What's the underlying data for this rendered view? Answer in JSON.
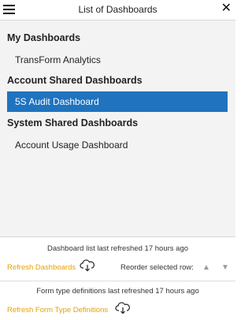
{
  "header": {
    "title": "List of Dashboards",
    "menu_icon": "hamburger-menu-icon",
    "close_symbol": "✕"
  },
  "sections": {
    "my": {
      "title": "My Dashboards",
      "items": [
        "TransForm Analytics"
      ]
    },
    "account": {
      "title": "Account Shared Dashboards",
      "items": [
        "5S Audit Dashboard"
      ],
      "selected_index": 0
    },
    "system": {
      "title": "System Shared Dashboards",
      "items": [
        "Account Usage Dashboard"
      ]
    }
  },
  "footer": {
    "dashboards_refresh_note": "Dashboard list last refreshed 17 hours ago",
    "refresh_dashboards_label": "Refresh Dashboards",
    "reorder_label": "Reorder selected row:",
    "up_arrow": "▲",
    "down_arrow": "▼",
    "form_types_refresh_note": "Form type definitions last refreshed 17 hours ago",
    "refresh_form_types_label": "Refresh Form Type Definitions",
    "cloud_icon": "cloud-download-icon"
  },
  "colors": {
    "selected_bg": "#1f73bf",
    "list_bg": "#f3f3f3",
    "link": "#e6a100"
  }
}
